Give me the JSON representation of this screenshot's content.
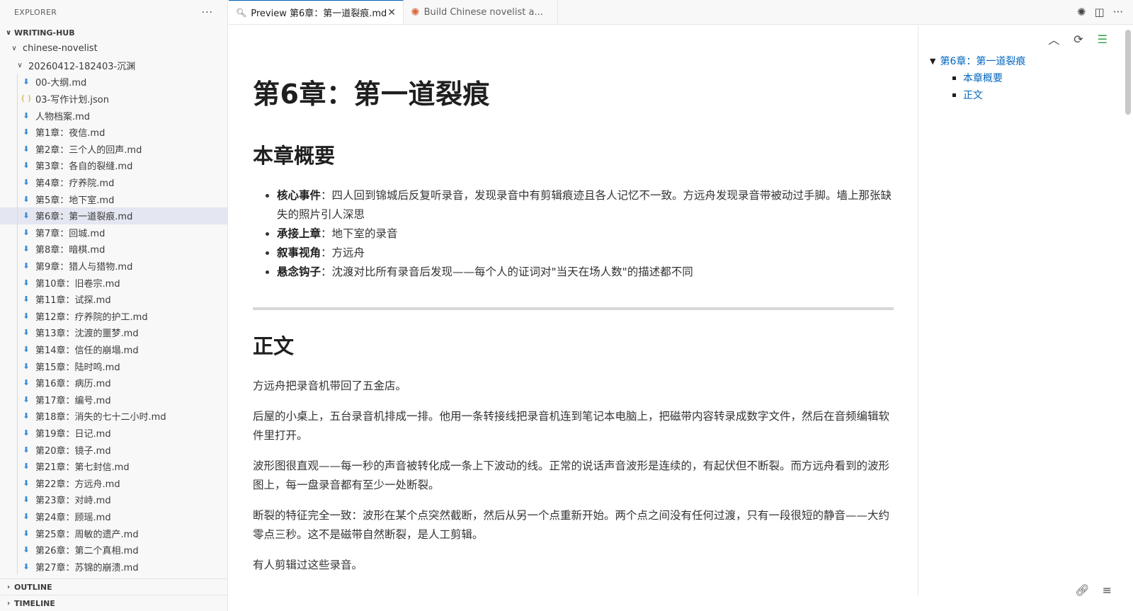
{
  "explorer": {
    "title": "EXPLORER",
    "more": "···",
    "workspace": "WRITING-HUB",
    "folder1": "chinese-novelist",
    "folder2": "20260412-182403-沉渊",
    "files": [
      {
        "name": "00-大纲.md",
        "type": "md"
      },
      {
        "name": "03-写作计划.json",
        "type": "json"
      },
      {
        "name": "人物档案.md",
        "type": "md"
      },
      {
        "name": "第1章：夜信.md",
        "type": "md"
      },
      {
        "name": "第2章：三个人的回声.md",
        "type": "md"
      },
      {
        "name": "第3章：各自的裂缝.md",
        "type": "md"
      },
      {
        "name": "第4章：疗养院.md",
        "type": "md"
      },
      {
        "name": "第5章：地下室.md",
        "type": "md"
      },
      {
        "name": "第6章：第一道裂痕.md",
        "type": "md",
        "selected": true
      },
      {
        "name": "第7章：回城.md",
        "type": "md"
      },
      {
        "name": "第8章：暗棋.md",
        "type": "md"
      },
      {
        "name": "第9章：猎人与猎物.md",
        "type": "md"
      },
      {
        "name": "第10章：旧卷宗.md",
        "type": "md"
      },
      {
        "name": "第11章：试探.md",
        "type": "md"
      },
      {
        "name": "第12章：疗养院的护工.md",
        "type": "md"
      },
      {
        "name": "第13章：沈渡的噩梦.md",
        "type": "md"
      },
      {
        "name": "第14章：信任的崩塌.md",
        "type": "md"
      },
      {
        "name": "第15章：陆时鸣.md",
        "type": "md"
      },
      {
        "name": "第16章：病历.md",
        "type": "md"
      },
      {
        "name": "第17章：编号.md",
        "type": "md"
      },
      {
        "name": "第18章：消失的七十二小时.md",
        "type": "md"
      },
      {
        "name": "第19章：日记.md",
        "type": "md"
      },
      {
        "name": "第20章：镜子.md",
        "type": "md"
      },
      {
        "name": "第21章：第七封信.md",
        "type": "md"
      },
      {
        "name": "第22章：方远舟.md",
        "type": "md"
      },
      {
        "name": "第23章：对峙.md",
        "type": "md"
      },
      {
        "name": "第24章：顾瑶.md",
        "type": "md"
      },
      {
        "name": "第25章：周敏的遗产.md",
        "type": "md"
      },
      {
        "name": "第26章：第二个真相.md",
        "type": "md"
      },
      {
        "name": "第27章：苏锦的崩溃.md",
        "type": "md"
      }
    ],
    "outline_label": "OUTLINE",
    "timeline_label": "TIMELINE"
  },
  "tabs": {
    "active": "Preview 第6章：第一道裂痕.md",
    "inactive": "Build Chinese novelist a..."
  },
  "document": {
    "title": "第6章：第一道裂痕",
    "summary_heading": "本章概要",
    "summary": [
      {
        "key": "核心事件",
        "value": "：四人回到锦城后反复听录音，发现录音中有剪辑痕迹且各人记忆不一致。方远舟发现录音带被动过手脚。墙上那张缺失的照片引人深思"
      },
      {
        "key": "承接上章",
        "value": "：地下室的录音"
      },
      {
        "key": "叙事视角",
        "value": "：方远舟"
      },
      {
        "key": "悬念钩子",
        "value": "：沈渡对比所有录音后发现——每个人的证词对\"当天在场人数\"的描述都不同"
      }
    ],
    "body_heading": "正文",
    "paragraphs": [
      "方远舟把录音机带回了五金店。",
      "后屋的小桌上，五台录音机排成一排。他用一条转接线把录音机连到笔记本电脑上，把磁带内容转录成数字文件，然后在音频编辑软件里打开。",
      "波形图很直观——每一秒的声音被转化成一条上下波动的线。正常的说话声音波形是连续的，有起伏但不断裂。而方远舟看到的波形图上，每一盘录音都有至少一处断裂。",
      "断裂的特征完全一致：波形在某个点突然截断，然后从另一个点重新开始。两个点之间没有任何过渡，只有一段很短的静音——大约零点三秒。这不是磁带自然断裂，是人工剪辑。",
      "有人剪辑过这些录音。"
    ]
  },
  "outline": {
    "root": "第6章：第一道裂痕",
    "children": [
      "本章概要",
      "正文"
    ]
  }
}
